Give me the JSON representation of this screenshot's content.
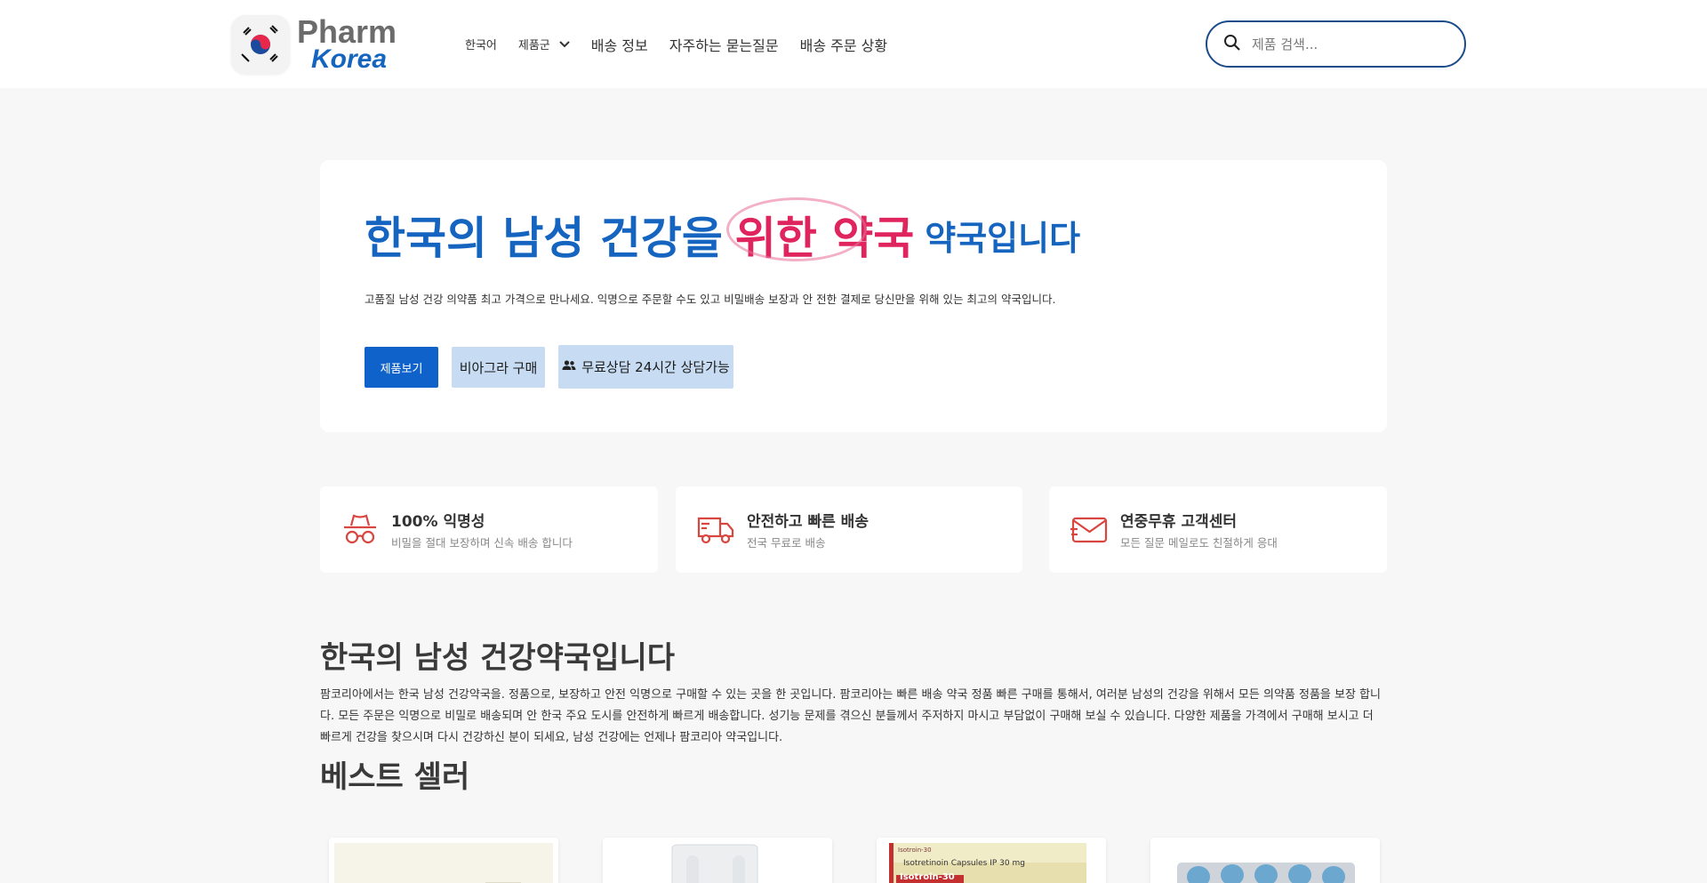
{
  "header": {
    "logo": {
      "word1": "Pharm",
      "word2": "Korea"
    },
    "nav": [
      {
        "label": "한국어"
      },
      {
        "label": "제품군"
      },
      {
        "label": "배송 정보"
      },
      {
        "label": "자주하는 묻는질문"
      },
      {
        "label": "배송 주문 상황"
      }
    ],
    "search": {
      "placeholder": "제품 검색..."
    }
  },
  "hero": {
    "title_part1": "한국의 남성 건강을",
    "title_part2": "위한 약국",
    "title_part3": "약국입니다",
    "subtitle": "고품질 남성 건강 의약품 최고 가격으로 만나세요. 익명으로 주문할 수도 있고 비밀배송 보장과 안 전한 결제로 당신만을 위해 있는 최고의 약국입니다.",
    "button_primary": "제품보기",
    "button_secondary": "비아그라 구매",
    "button_counsel": "무료상담 24시간 상담가능"
  },
  "features": [
    {
      "title": "100% 익명성",
      "desc": "비밀을 절대 보장하며 신속 배송 합니다",
      "icon": "incognito-icon"
    },
    {
      "title": "안전하고 빠른 배송",
      "desc": "전국 무료로 배송",
      "icon": "truck-icon"
    },
    {
      "title": "연중무휴 고객센터",
      "desc": "모든 질문 메일로도 친절하게 응대",
      "icon": "envelope-icon"
    }
  ],
  "intro": {
    "title": "한국의 남성 건강약국입니다",
    "text": "팜코리아에서는 한국 남성 건강약국을. 정품으로, 보장하고 안전 익명으로 구매할 수 있는 곳을 한 곳입니다. 팜코리아는 빠른 배송 약국 정품 빠른 구매를 통해서, 여러분 남성의 건강을 위해서 모든 의약품 정품을 보장 합니다. 모든 주문은 익명으로 비밀로 배송되며 안 한국 주요 도시를 안전하게 빠르게 배송합니다. 성기능 문제를 겪으신 분들께서 주저하지 마시고 부담없이 구매해 보실 수 있습니다. 다양한 제품을 가격에서 구매해 보시고 더 빠르게 건강을 찾으시며 다시 건강하신 분이 되세요, 남성 건강에는 언제나 팜코리아 약국입니다."
  },
  "bestsellers": {
    "title": "베스트 셀러",
    "products": [
      {
        "image": "pill-box-icon"
      },
      {
        "image": "blister-pack-icon"
      },
      {
        "image": "isotroin-box-icon",
        "label_line1": "Isotretinoin Capsules IP 30 mg",
        "label_line2": "Isotroin-30",
        "brand": "Isotroin-30"
      },
      {
        "image": "blue-pill-strip-icon"
      }
    ]
  },
  "colors": {
    "primary_blue": "#1565c0",
    "accent_pink": "#e0245e",
    "button_blue": "#0f62c9",
    "button_light": "#c7dcf3",
    "icon_red": "#d9453f"
  }
}
